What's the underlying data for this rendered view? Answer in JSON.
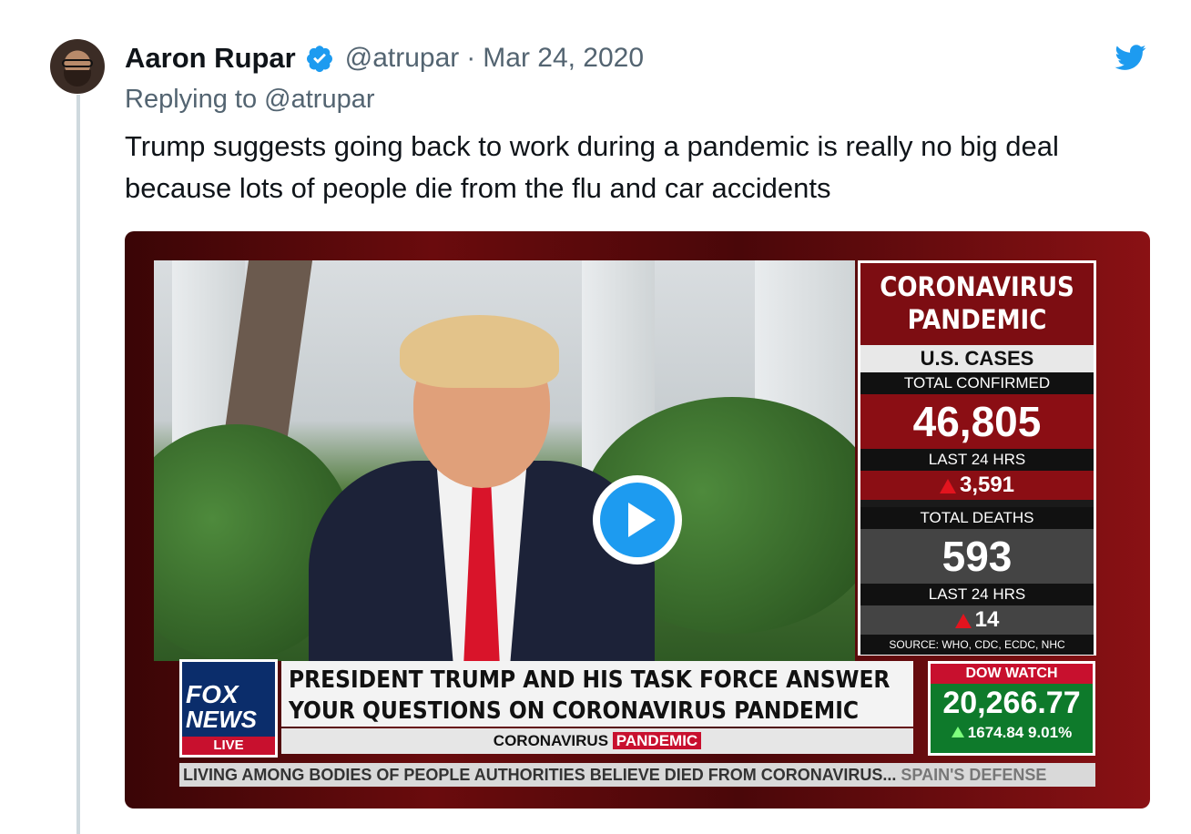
{
  "tweet": {
    "author_name": "Aaron Rupar",
    "handle": "@atrupar",
    "separator": "·",
    "date": "Mar 24, 2020",
    "reply_prefix": "Replying to",
    "reply_handle": "@atrupar",
    "text": "Trump suggests going back to work during a pandemic is really no big deal because lots of people die from the flu and car accidents"
  },
  "icons": {
    "verified": "verified-badge-icon",
    "brand": "twitter-bird-icon",
    "play": "play-icon"
  },
  "colors": {
    "twitter_blue": "#1d9bf0",
    "text": "#0f1419",
    "secondary": "#536471",
    "fox_red": "#c8102e",
    "dow_green": "#0e7a2b"
  },
  "video": {
    "panel": {
      "title_line1": "CORONAVIRUS",
      "title_line2": "PANDEMIC",
      "subtitle": "U.S. CASES",
      "confirmed_label": "TOTAL CONFIRMED",
      "confirmed_value": "46,805",
      "last24_label_1": "LAST 24 HRS",
      "last24_value_1": "3,591",
      "deaths_label": "TOTAL DEATHS",
      "deaths_value": "593",
      "last24_label_2": "LAST 24 HRS",
      "last24_value_2": "14",
      "source": "SOURCE: WHO, CDC, ECDC, NHC"
    },
    "logo": {
      "line1": "FOX",
      "line2": "NEWS",
      "live": "LIVE"
    },
    "headline_line1": "PRESIDENT TRUMP AND HIS TASK FORCE ANSWER",
    "headline_line2": "YOUR QUESTIONS ON CORONAVIRUS PANDEMIC",
    "tag_a": "CORONAVIRUS",
    "tag_b": "PANDEMIC",
    "dow": {
      "title": "DOW WATCH",
      "value": "20,266.77",
      "change": "1674.84",
      "percent": "9.01%"
    },
    "ticker_text": "LIVING AMONG BODIES OF PEOPLE AUTHORITIES BELIEVE DIED FROM CORONAVIRUS...",
    "ticker_next": "SPAIN'S DEFENSE"
  }
}
